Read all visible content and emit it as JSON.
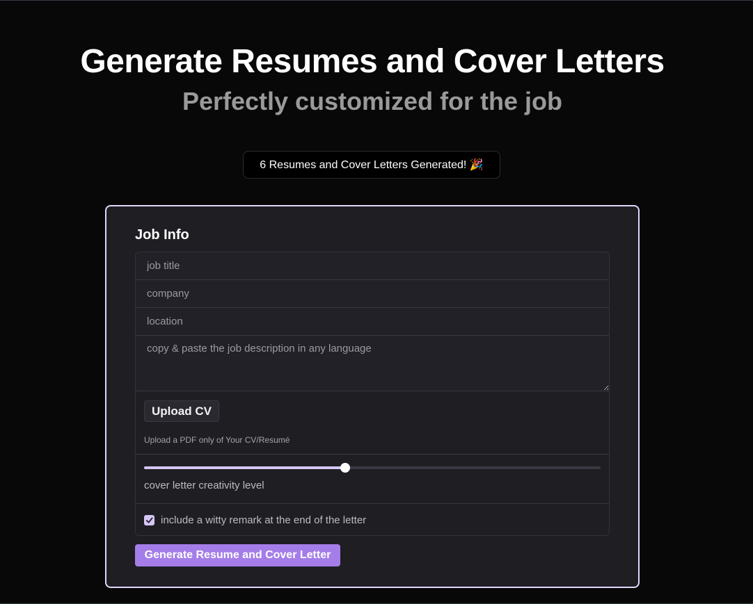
{
  "hero": {
    "title": "Generate Resumes and Cover Letters",
    "subtitle": "Perfectly customized for the job"
  },
  "counter": {
    "text": "6 Resumes and Cover Letters Generated! 🎉"
  },
  "form": {
    "title": "Job Info",
    "job_title": {
      "value": "",
      "placeholder": "job title"
    },
    "company": {
      "value": "",
      "placeholder": "company"
    },
    "location": {
      "value": "",
      "placeholder": "location"
    },
    "job_description": {
      "value": "",
      "placeholder": "copy & paste the job description in any language"
    },
    "upload": {
      "button_label": "Upload CV",
      "hint": "Upload a PDF only of Your CV/Resumé"
    },
    "creativity": {
      "label": "cover letter creativity level",
      "level": 0.44
    },
    "witty_remark": {
      "label": "include a witty remark at the end of the letter",
      "checked": true
    },
    "submit_label": "Generate Resume and Cover Letter"
  },
  "colors": {
    "background": "#080808",
    "card": "#1f1e23",
    "card_border": "#e2d6fb",
    "accent": "#a47de9",
    "accent_light": "#d6c6f7",
    "subtitle_gray": "#9a9a9a"
  },
  "icons": {
    "badge_icon": "party-popper-icon",
    "checkbox_mark": "checkmark-icon"
  }
}
